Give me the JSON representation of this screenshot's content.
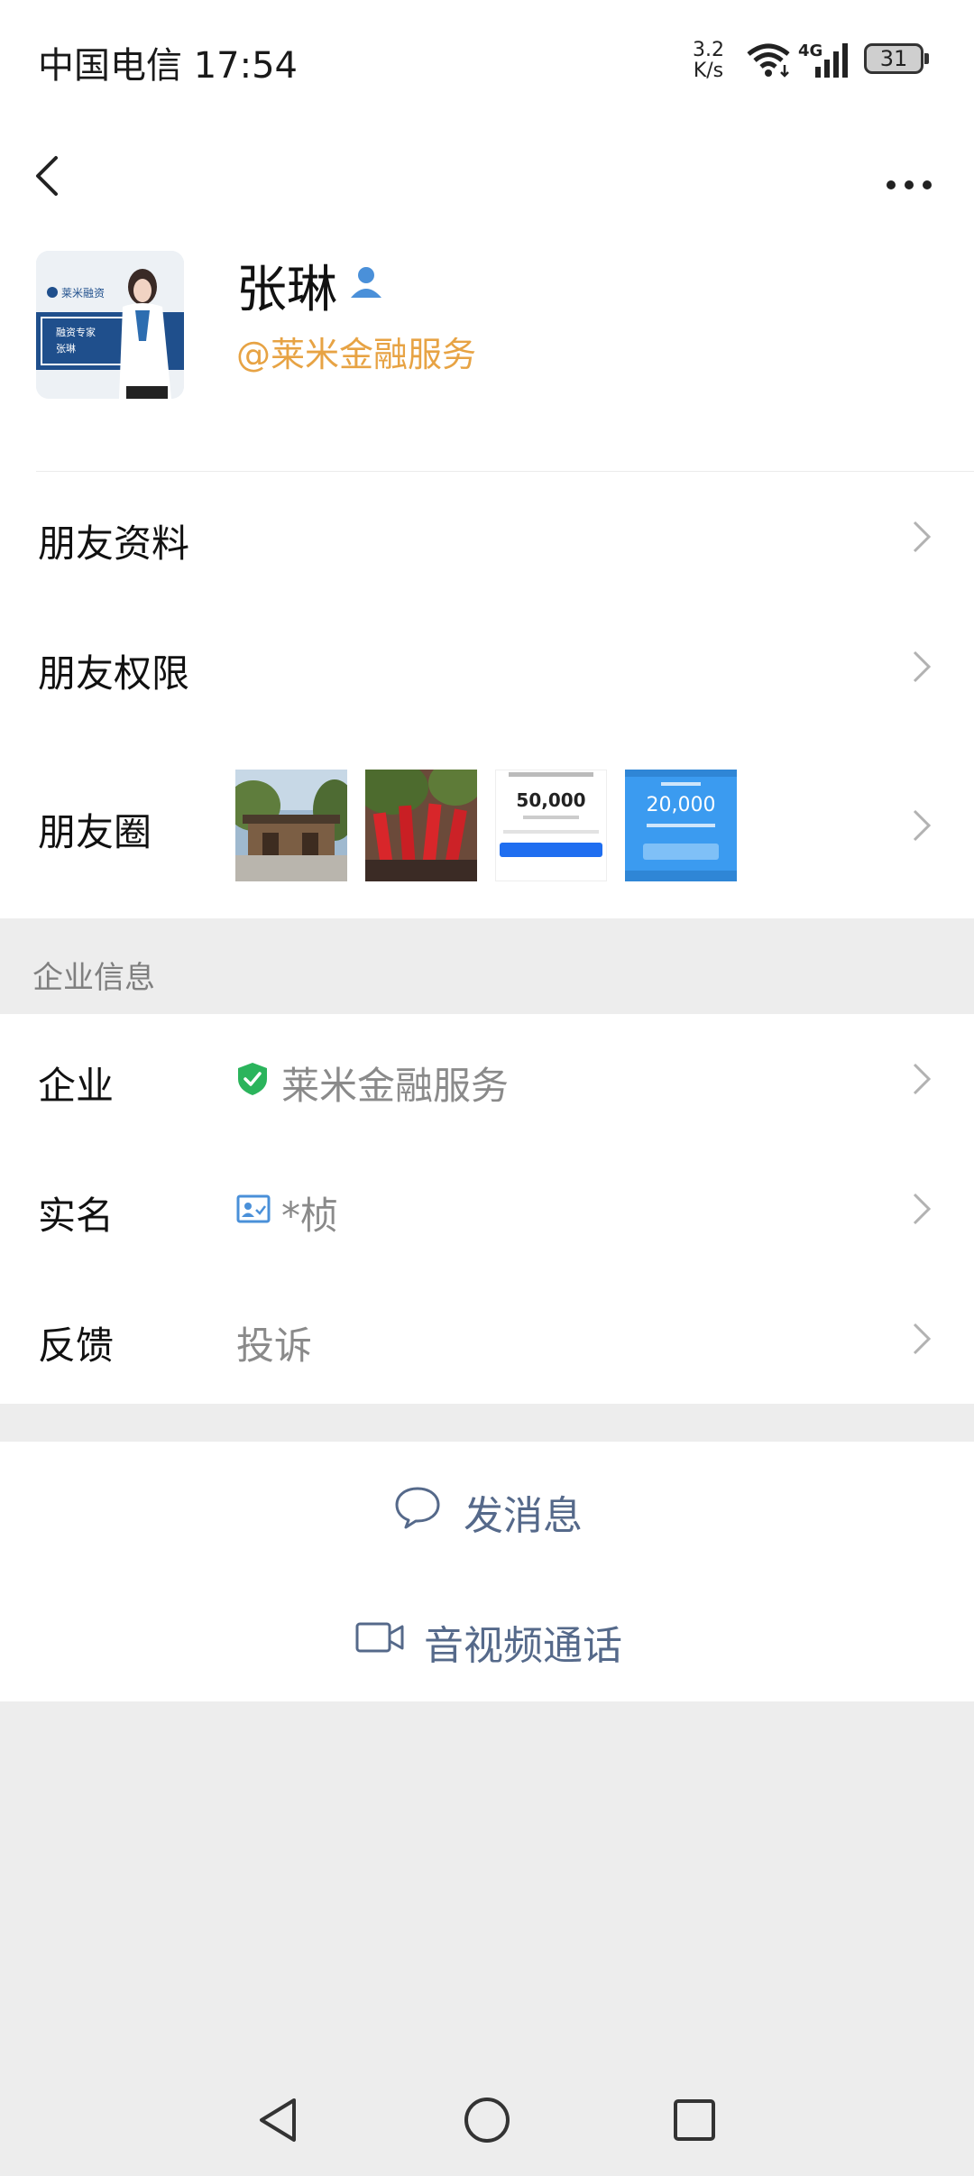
{
  "status_bar": {
    "carrier_time": "中国电信 17:54",
    "speed_value": "3.2",
    "speed_unit": "K/s",
    "network": "4G",
    "battery": "31"
  },
  "profile": {
    "name": "张琳",
    "company_tag": "@莱米金融服务",
    "avatar_text_brand": "莱米融资",
    "avatar_text_role": "融资专家",
    "avatar_text_name": "张琳"
  },
  "rows": {
    "friend_info": "朋友资料",
    "friend_permissions": "朋友权限",
    "moments": "朋友圈"
  },
  "moments_thumbs": {
    "thumb3_amount": "50,000",
    "thumb4_amount": "20,000"
  },
  "enterprise": {
    "section_title": "企业信息",
    "company_label": "企业",
    "company_value": "莱米金融服务",
    "realname_label": "实名",
    "realname_value": "*桢",
    "feedback_label": "反馈",
    "feedback_value": "投诉"
  },
  "actions": {
    "send_message": "发消息",
    "av_call": "音视频通话"
  },
  "colors": {
    "accent_orange": "#e7a344",
    "action_blue": "#55698a",
    "verified_green": "#2bb45c",
    "person_blue": "#4a90d9"
  }
}
